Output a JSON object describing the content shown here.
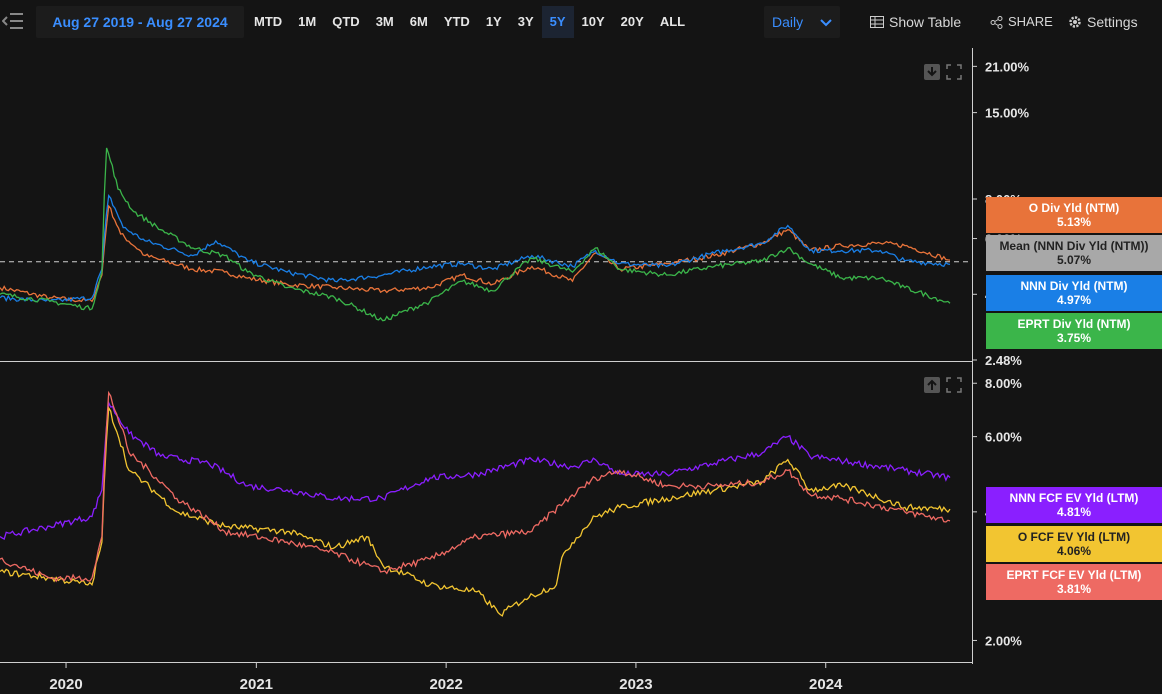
{
  "toolbar": {
    "date_range": "Aug 27 2019 - Aug 27 2024",
    "ranges": [
      "MTD",
      "1M",
      "QTD",
      "3M",
      "6M",
      "YTD",
      "1Y",
      "3Y",
      "5Y",
      "10Y",
      "20Y",
      "ALL"
    ],
    "active_range": "5Y",
    "frequency": "Daily",
    "show_table": "Show Table",
    "share": "SHARE",
    "settings": "Settings"
  },
  "colors": {
    "o": "#e8733a",
    "nnn": "#1a7fe6",
    "eprt": "#3bb54a",
    "mean": "#a8a8a8",
    "nnn_fcf": "#8a1fff",
    "o_fcf": "#f2c531",
    "eprt_fcf": "#ee6a63",
    "accent": "#3a8eff"
  },
  "chart_data": [
    {
      "type": "line",
      "title": "",
      "y_scale": "log",
      "y_tick_labels": [
        "21.00%",
        "15.00%",
        "8.00%",
        "6.00%",
        "4.00%",
        "2.48%"
      ],
      "y_ticks": [
        21,
        15,
        8,
        6,
        4,
        2.48
      ],
      "ylim": [
        2.48,
        24
      ],
      "x_tick_labels": [
        "2020",
        "2021",
        "2022",
        "2023",
        "2024"
      ],
      "x_range": [
        "2019-08-27",
        "2024-08-27"
      ],
      "reference_line": {
        "label": "Mean (NNN Div Yld (NTM))",
        "value": 5.07
      },
      "series": [
        {
          "name": "O Div Yld (NTM)",
          "color_key": "o",
          "last_label": "5.13%",
          "points": [
            [
              "2019-08-27",
              4.2
            ],
            [
              "2019-12-01",
              3.9
            ],
            [
              "2020-02-20",
              3.8
            ],
            [
              "2020-03-10",
              4.6
            ],
            [
              "2020-03-23",
              7.6
            ],
            [
              "2020-04-15",
              6.2
            ],
            [
              "2020-06-01",
              5.3
            ],
            [
              "2020-09-01",
              4.8
            ],
            [
              "2020-11-01",
              4.7
            ],
            [
              "2020-12-15",
              4.5
            ],
            [
              "2021-03-01",
              4.3
            ],
            [
              "2021-06-01",
              4.2
            ],
            [
              "2021-09-01",
              4.1
            ],
            [
              "2021-12-01",
              4.2
            ],
            [
              "2022-02-01",
              4.6
            ],
            [
              "2022-04-01",
              4.3
            ],
            [
              "2022-06-15",
              4.9
            ],
            [
              "2022-09-01",
              4.4
            ],
            [
              "2022-10-15",
              5.4
            ],
            [
              "2022-12-01",
              4.8
            ],
            [
              "2023-03-01",
              5.0
            ],
            [
              "2023-06-01",
              5.3
            ],
            [
              "2023-09-01",
              5.8
            ],
            [
              "2023-10-20",
              6.4
            ],
            [
              "2023-12-01",
              5.5
            ],
            [
              "2024-02-01",
              5.7
            ],
            [
              "2024-04-15",
              5.8
            ],
            [
              "2024-06-01",
              5.7
            ],
            [
              "2024-08-27",
              5.13
            ]
          ]
        },
        {
          "name": "NNN Div Yld (NTM)",
          "color_key": "nnn",
          "last_label": "4.97%",
          "points": [
            [
              "2019-08-27",
              3.9
            ],
            [
              "2019-12-01",
              3.8
            ],
            [
              "2020-02-20",
              3.9
            ],
            [
              "2020-03-10",
              4.8
            ],
            [
              "2020-03-23",
              8.2
            ],
            [
              "2020-04-20",
              6.5
            ],
            [
              "2020-06-01",
              5.9
            ],
            [
              "2020-09-01",
              5.3
            ],
            [
              "2020-10-15",
              5.9
            ],
            [
              "2020-12-15",
              5.1
            ],
            [
              "2021-03-01",
              4.7
            ],
            [
              "2021-06-01",
              4.4
            ],
            [
              "2021-09-01",
              4.6
            ],
            [
              "2021-12-01",
              4.9
            ],
            [
              "2022-02-01",
              5.0
            ],
            [
              "2022-04-01",
              4.8
            ],
            [
              "2022-06-15",
              5.3
            ],
            [
              "2022-09-01",
              4.9
            ],
            [
              "2022-10-15",
              5.5
            ],
            [
              "2022-12-01",
              5.0
            ],
            [
              "2023-03-01",
              4.9
            ],
            [
              "2023-06-01",
              5.4
            ],
            [
              "2023-09-01",
              5.8
            ],
            [
              "2023-10-20",
              6.6
            ],
            [
              "2023-12-01",
              5.5
            ],
            [
              "2024-02-01",
              5.5
            ],
            [
              "2024-04-15",
              5.5
            ],
            [
              "2024-06-01",
              5.1
            ],
            [
              "2024-08-27",
              4.97
            ]
          ]
        },
        {
          "name": "EPRT Div Yld (NTM)",
          "color_key": "eprt",
          "last_label": "3.75%",
          "points": [
            [
              "2019-08-27",
              4.0
            ],
            [
              "2019-12-01",
              3.8
            ],
            [
              "2020-02-20",
              3.6
            ],
            [
              "2020-03-10",
              4.7
            ],
            [
              "2020-03-19",
              11.6
            ],
            [
              "2020-04-10",
              8.6
            ],
            [
              "2020-05-10",
              7.3
            ],
            [
              "2020-07-01",
              6.4
            ],
            [
              "2020-09-01",
              5.6
            ],
            [
              "2020-11-01",
              5.3
            ],
            [
              "2020-12-15",
              4.7
            ],
            [
              "2021-03-01",
              4.2
            ],
            [
              "2021-06-01",
              3.9
            ],
            [
              "2021-09-01",
              3.3
            ],
            [
              "2021-12-01",
              3.8
            ],
            [
              "2022-02-01",
              4.4
            ],
            [
              "2022-04-01",
              4.1
            ],
            [
              "2022-06-15",
              5.2
            ],
            [
              "2022-09-01",
              4.7
            ],
            [
              "2022-10-15",
              5.6
            ],
            [
              "2022-12-01",
              4.8
            ],
            [
              "2023-03-01",
              4.6
            ],
            [
              "2023-06-01",
              4.9
            ],
            [
              "2023-09-01",
              5.1
            ],
            [
              "2023-10-20",
              5.6
            ],
            [
              "2023-12-01",
              5.0
            ],
            [
              "2024-02-01",
              4.5
            ],
            [
              "2024-04-15",
              4.5
            ],
            [
              "2024-06-01",
              4.2
            ],
            [
              "2024-08-27",
              3.75
            ]
          ]
        }
      ]
    },
    {
      "type": "line",
      "title": "",
      "y_scale": "log",
      "y_tick_labels": [
        "8.00%",
        "6.00%",
        "4.00%",
        "2.00%"
      ],
      "y_ticks": [
        8,
        6,
        4,
        2
      ],
      "ylim": [
        1.8,
        8.5
      ],
      "x_tick_labels": [
        "2020",
        "2021",
        "2022",
        "2023",
        "2024"
      ],
      "x_range": [
        "2019-08-27",
        "2024-08-27"
      ],
      "series": [
        {
          "name": "NNN FCF EV Yld (LTM)",
          "color_key": "nnn_fcf",
          "last_label": "4.81%",
          "points": [
            [
              "2019-08-27",
              3.5
            ],
            [
              "2019-12-01",
              3.7
            ],
            [
              "2020-02-20",
              3.9
            ],
            [
              "2020-03-10",
              4.5
            ],
            [
              "2020-03-23",
              7.2
            ],
            [
              "2020-05-01",
              6.1
            ],
            [
              "2020-07-01",
              5.4
            ],
            [
              "2020-10-01",
              5.2
            ],
            [
              "2020-12-15",
              4.6
            ],
            [
              "2021-03-01",
              4.5
            ],
            [
              "2021-06-01",
              4.3
            ],
            [
              "2021-09-01",
              4.3
            ],
            [
              "2021-12-01",
              4.8
            ],
            [
              "2022-03-01",
              4.9
            ],
            [
              "2022-06-15",
              5.3
            ],
            [
              "2022-09-01",
              5.1
            ],
            [
              "2022-10-15",
              5.3
            ],
            [
              "2022-12-01",
              4.9
            ],
            [
              "2023-03-01",
              4.9
            ],
            [
              "2023-06-01",
              5.2
            ],
            [
              "2023-09-01",
              5.5
            ],
            [
              "2023-10-20",
              6.0
            ],
            [
              "2023-12-01",
              5.4
            ],
            [
              "2024-03-01",
              5.2
            ],
            [
              "2024-06-01",
              5.0
            ],
            [
              "2024-08-27",
              4.81
            ]
          ]
        },
        {
          "name": "O FCF EV Yld (LTM)",
          "color_key": "o_fcf",
          "last_label": "4.06%",
          "points": [
            [
              "2019-08-27",
              2.9
            ],
            [
              "2019-12-01",
              2.8
            ],
            [
              "2020-02-20",
              2.7
            ],
            [
              "2020-03-10",
              3.4
            ],
            [
              "2020-03-23",
              7.0
            ],
            [
              "2020-05-01",
              5.0
            ],
            [
              "2020-08-01",
              4.0
            ],
            [
              "2020-11-01",
              3.7
            ],
            [
              "2021-03-01",
              3.6
            ],
            [
              "2021-06-01",
              3.3
            ],
            [
              "2021-08-01",
              3.5
            ],
            [
              "2021-09-01",
              3.0
            ],
            [
              "2021-12-01",
              2.7
            ],
            [
              "2022-03-01",
              2.6
            ],
            [
              "2022-04-15",
              2.3
            ],
            [
              "2022-06-01",
              2.5
            ],
            [
              "2022-08-01",
              2.7
            ],
            [
              "2022-08-15",
              3.2
            ],
            [
              "2022-10-15",
              3.9
            ],
            [
              "2022-12-01",
              4.1
            ],
            [
              "2023-03-01",
              4.3
            ],
            [
              "2023-06-01",
              4.5
            ],
            [
              "2023-09-01",
              4.7
            ],
            [
              "2023-10-20",
              5.3
            ],
            [
              "2023-12-01",
              4.5
            ],
            [
              "2024-02-01",
              4.6
            ],
            [
              "2024-03-01",
              4.5
            ],
            [
              "2024-06-01",
              4.1
            ],
            [
              "2024-08-27",
              4.06
            ]
          ]
        },
        {
          "name": "EPRT FCF EV Yld (LTM)",
          "color_key": "eprt_fcf",
          "last_label": "3.81%",
          "points": [
            [
              "2019-08-27",
              3.1
            ],
            [
              "2019-12-01",
              2.8
            ],
            [
              "2020-02-20",
              2.8
            ],
            [
              "2020-03-10",
              3.5
            ],
            [
              "2020-03-23",
              7.6
            ],
            [
              "2020-05-01",
              5.5
            ],
            [
              "2020-08-01",
              4.3
            ],
            [
              "2020-11-01",
              3.6
            ],
            [
              "2021-03-01",
              3.4
            ],
            [
              "2021-06-01",
              3.2
            ],
            [
              "2021-09-01",
              2.9
            ],
            [
              "2021-12-01",
              3.1
            ],
            [
              "2022-03-01",
              3.5
            ],
            [
              "2022-06-15",
              3.6
            ],
            [
              "2022-08-15",
              4.2
            ],
            [
              "2022-10-15",
              4.8
            ],
            [
              "2022-12-01",
              5.0
            ],
            [
              "2023-03-01",
              4.6
            ],
            [
              "2023-06-01",
              4.6
            ],
            [
              "2023-09-01",
              4.7
            ],
            [
              "2023-10-20",
              5.0
            ],
            [
              "2023-12-01",
              4.4
            ],
            [
              "2024-02-01",
              4.3
            ],
            [
              "2024-06-01",
              4.0
            ],
            [
              "2024-08-27",
              3.81
            ]
          ]
        }
      ]
    }
  ]
}
